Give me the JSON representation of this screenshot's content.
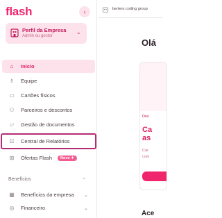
{
  "brand": {
    "logo": "flash",
    "collapse_icon": "‹",
    "accent": "#f0266d"
  },
  "profile": {
    "title": "Perfil da Empresa",
    "subtitle": "Admin ou gestor",
    "chevron": "⌄"
  },
  "menu": {
    "items": [
      {
        "label": "Início",
        "icon": "home-icon",
        "active": true
      },
      {
        "label": "Equipe",
        "icon": "team-icon"
      },
      {
        "label": "Cartões físicos",
        "icon": "card-icon"
      },
      {
        "label": "Parceiros e descontos",
        "icon": "partners-icon"
      },
      {
        "label": "Gestão de documentos",
        "icon": "folder-icon"
      },
      {
        "label": "Central de Relatórios",
        "icon": "reports-icon",
        "highlighted": true
      },
      {
        "label": "Ofertas Flash",
        "icon": "offers-icon",
        "badge": "Novo ✦"
      }
    ],
    "section": {
      "label": "Benefícios",
      "chevron": "⌃"
    },
    "section_items": [
      {
        "label": "Benefícios da empresa",
        "icon": "benefits-icon",
        "chevron": "⌄"
      },
      {
        "label": "Financeiro",
        "icon": "finance-icon",
        "chevron": "⌄"
      }
    ]
  },
  "main": {
    "company": "bertero coding group",
    "greeting": "Olá",
    "card": {
      "tag": "Des",
      "title_line1": "Ca",
      "title_line2": "as",
      "text_line1": "Car",
      "text_line2": "com"
    },
    "bottom_label": "Ace"
  }
}
